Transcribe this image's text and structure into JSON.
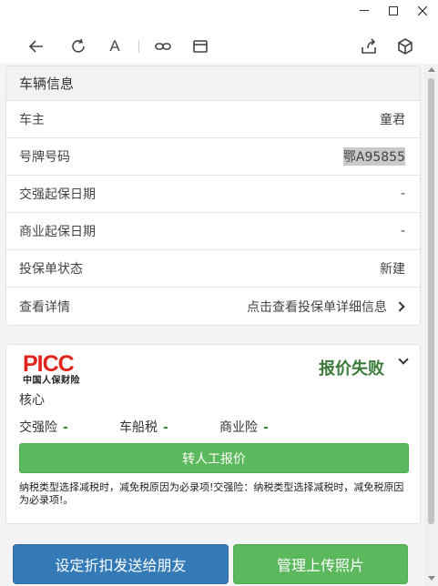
{
  "window": {
    "controls": [
      "minimize-icon",
      "maximize-icon",
      "close-icon"
    ]
  },
  "toolbar": {
    "icons": [
      "back-arrow-icon",
      "refresh-icon",
      "font-size-icon",
      "link-icon",
      "window-icon",
      "share-icon",
      "package-icon"
    ],
    "font_glyph": "A"
  },
  "vehicle_info": {
    "title": "车辆信息",
    "rows": [
      {
        "label": "车主",
        "value": "童君"
      },
      {
        "label": "号牌号码",
        "value": "鄂A95855"
      },
      {
        "label": "交强起保日期",
        "value": "-"
      },
      {
        "label": "商业起保日期",
        "value": "-"
      },
      {
        "label": "投保单状态",
        "value": "新建"
      },
      {
        "label": "查看详情",
        "value": "点击查看投保单详细信息"
      }
    ]
  },
  "quote": {
    "logo_text": "PICC",
    "logo_sub": "中国人保财险",
    "status": "报价失败",
    "core_label": "核心",
    "insurances": [
      {
        "label": "交强险",
        "value": "-"
      },
      {
        "label": "车船税",
        "value": "-"
      },
      {
        "label": "商业险",
        "value": "-"
      }
    ],
    "manual_button": "转人工报价",
    "note": "纳税类型选择减税时，减免税原因为必录项!交强险：纳税类型选择减税时，减免税原因为必录项!。"
  },
  "actions": {
    "share_button": "设定折扣发送给朋友",
    "photo_button": "管理上传照片"
  },
  "colors": {
    "success": "#5cb85c",
    "primary": "#337ab7",
    "fail_text": "#3b7a3b",
    "brand_red": "#e0251b"
  }
}
